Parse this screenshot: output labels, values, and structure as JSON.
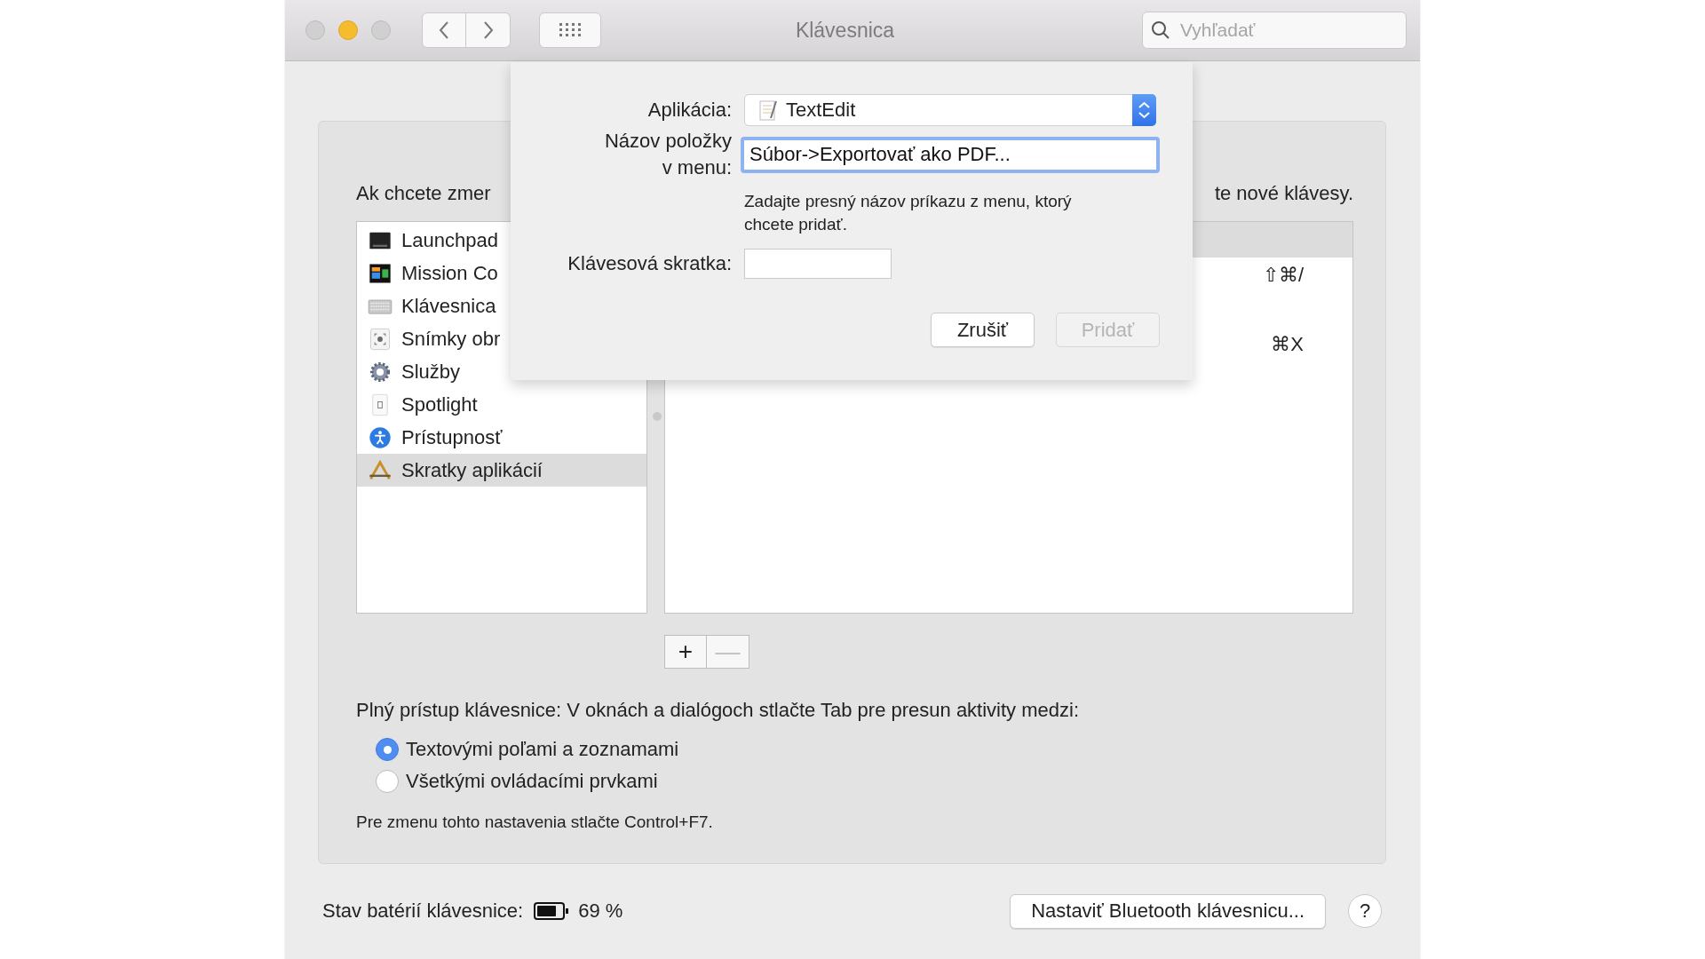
{
  "window": {
    "title": "Klávesnica",
    "search_placeholder": "Vyhľadať"
  },
  "panel": {
    "intro_left": "Ak chcete zmer",
    "intro_right": "te nové klávesy.",
    "categories": [
      {
        "label": "Launchpad",
        "kind": "launchpad",
        "selected": false
      },
      {
        "label": "Mission Co",
        "kind": "mission",
        "selected": false
      },
      {
        "label": "Klávesnica",
        "kind": "keyboard",
        "selected": false
      },
      {
        "label": "Snímky obr",
        "kind": "screenshot",
        "selected": false
      },
      {
        "label": "Služby",
        "kind": "services",
        "selected": false
      },
      {
        "label": "Spotlight",
        "kind": "spotlight",
        "selected": false
      },
      {
        "label": "Prístupnosť",
        "kind": "accessibility",
        "selected": false
      },
      {
        "label": "Skratky aplikácií",
        "kind": "appshortcuts",
        "selected": true
      }
    ],
    "shortcuts": [
      "⇧⌘/",
      "⌘X"
    ],
    "add_button": "+",
    "remove_button": {
      "label": "—",
      "disabled": true
    }
  },
  "full_access": {
    "label": "Plný prístup klávesnice: V oknách a dialógoch stlačte Tab pre presun aktivity medzi:",
    "options": [
      {
        "label": "Textovými poľami a zoznamami",
        "selected": true
      },
      {
        "label": "Všetkými ovládacími prvkami",
        "selected": false
      }
    ],
    "hint": "Pre zmenu tohto nastavenia stlačte Control+F7."
  },
  "battery": {
    "label": "Stav batérií klávesnice:",
    "percent": "69 %"
  },
  "bluetooth_button": "Nastaviť Bluetooth klávesnicu...",
  "help_button": "?",
  "sheet": {
    "application_label": "Aplikácia:",
    "application": "TextEdit",
    "menu_title_label": "Názov položky v menu:",
    "menu_title": "Súbor->Exportovať ako PDF...",
    "hint": "Zadajte presný názov príkazu z menu, ktorý chcete pridať.",
    "shortcut_label": "Klávesová skratka:",
    "buttons": [
      {
        "label": "Zrušiť",
        "disabled": false
      },
      {
        "label": "Pridať",
        "disabled": true
      }
    ]
  }
}
